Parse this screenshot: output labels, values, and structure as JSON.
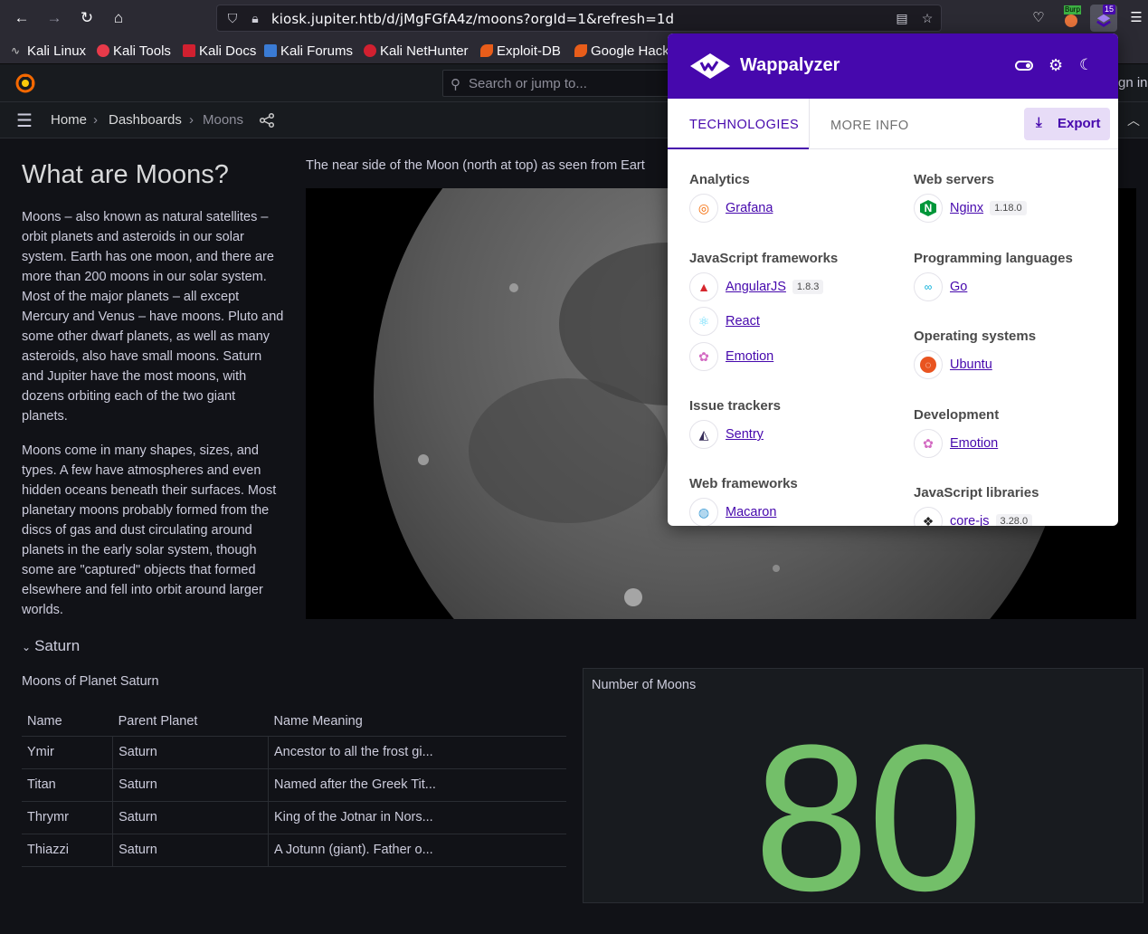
{
  "browser": {
    "url": "kiosk.jupiter.htb/d/jMgFGfA4z/moons?orgId=1&refresh=1d",
    "ext_badge": "15",
    "burp_label": "Burp",
    "bookmarks": [
      "Kali Linux",
      "Kali Tools",
      "Kali Docs",
      "Kali Forums",
      "Kali NetHunter",
      "Exploit-DB",
      "Google Hack"
    ]
  },
  "grafana": {
    "search_placeholder": "Search or jump to...",
    "sign_in": "gn in",
    "breadcrumb": {
      "home": "Home",
      "dashboards": "Dashboards",
      "current": "Moons"
    }
  },
  "text_panel": {
    "title": "What are Moons?",
    "p1": "Moons – also known as natural satellites – orbit planets and asteroids in our solar system. Earth has one moon, and there are more than 200 moons in our solar system. Most of the major planets – all except Mercury and Venus – have moons. Pluto and some other dwarf planets, as well as many asteroids, also have small moons. Saturn and Jupiter have the most moons, with dozens orbiting each of the two giant planets.",
    "p2": "Moons come in many shapes, sizes, and types. A few have atmospheres and even hidden oceans beneath their surfaces. Most planetary moons probably formed from the discs of gas and dust circulating around planets in the early solar system, though some are \"captured\" objects that formed elsewhere and fell into orbit around larger worlds."
  },
  "moon_panel": {
    "title": "The near side of the Moon (north at top) as seen from Eart"
  },
  "row": {
    "title": "Saturn"
  },
  "table": {
    "title": "Moons of Planet Saturn",
    "headers": [
      "Name",
      "Parent Planet",
      "Name Meaning"
    ],
    "rows": [
      [
        "Ymir",
        "Saturn",
        "Ancestor to all the frost gi..."
      ],
      [
        "Titan",
        "Saturn",
        "Named after the Greek Tit..."
      ],
      [
        "Thrymr",
        "Saturn",
        "King of the Jotnar in Nors..."
      ],
      [
        "Thiazzi",
        "Saturn",
        "A Jotunn (giant). Father o..."
      ]
    ]
  },
  "stat": {
    "title": "Number of Moons",
    "value": "80",
    "color": "#73bf69"
  },
  "wappalyzer": {
    "name": "Wappalyzer",
    "tabs": [
      "TECHNOLOGIES",
      "MORE INFO"
    ],
    "export": "Export",
    "brand_color": "#4608ad",
    "left": [
      {
        "category": "Analytics",
        "items": [
          {
            "name": "Grafana",
            "version": ""
          }
        ]
      },
      {
        "category": "JavaScript frameworks",
        "items": [
          {
            "name": "AngularJS",
            "version": "1.8.3"
          },
          {
            "name": "React",
            "version": ""
          },
          {
            "name": "Emotion",
            "version": ""
          }
        ]
      },
      {
        "category": "Issue trackers",
        "items": [
          {
            "name": "Sentry",
            "version": ""
          }
        ]
      },
      {
        "category": "Web frameworks",
        "items": [
          {
            "name": "Macaron",
            "version": ""
          }
        ]
      }
    ],
    "right": [
      {
        "category": "Web servers",
        "items": [
          {
            "name": "Nginx",
            "version": "1.18.0"
          }
        ]
      },
      {
        "category": "Programming languages",
        "items": [
          {
            "name": "Go",
            "version": ""
          }
        ]
      },
      {
        "category": "Operating systems",
        "items": [
          {
            "name": "Ubuntu",
            "version": ""
          }
        ]
      },
      {
        "category": "Development",
        "items": [
          {
            "name": "Emotion",
            "version": ""
          }
        ]
      },
      {
        "category": "JavaScript libraries",
        "items": [
          {
            "name": "core-js",
            "version": "3.28.0"
          }
        ]
      }
    ]
  }
}
